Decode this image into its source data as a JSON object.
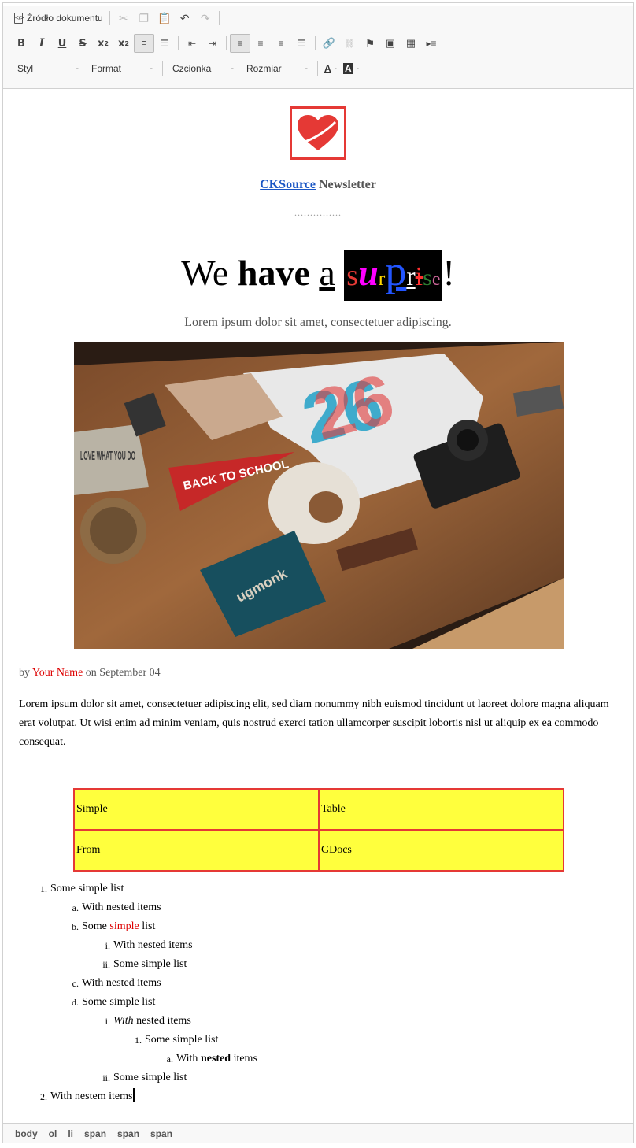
{
  "toolbar": {
    "source_label": "Źródło dokumentu",
    "combos": {
      "style": "Styl",
      "format": "Format",
      "font": "Czcionka",
      "size": "Rozmiar"
    },
    "font_color_glyph": "A",
    "bg_color_glyph": "A"
  },
  "content": {
    "newsletter": {
      "brand": "CKSource",
      "suffix": " Newsletter"
    },
    "dots": "...............",
    "headline": {
      "w1": "We",
      "w2": "have",
      "w3": "a",
      "surprise_letters": [
        "s",
        "u",
        "r",
        "p",
        "r",
        "i",
        "s",
        "e"
      ],
      "end": "!"
    },
    "lead": "Lorem ipsum dolor sit amet, consectetuer adipiscing.",
    "byline": {
      "by": "by ",
      "name": "Your Name",
      "rest": " on September 04"
    },
    "paragraph": "Lorem ipsum dolor sit amet, consectetuer adipiscing elit, sed diam nonummy nibh euismod tincidunt ut laoreet dolore magna aliquam erat volutpat. Ut wisi enim ad minim veniam, quis nostrud exerci tation ullamcorper suscipit lobortis nisl ut aliquip ex ea commodo consequat.",
    "table": [
      [
        "Simple",
        "Table"
      ],
      [
        "From",
        "GDocs"
      ]
    ],
    "photo_texts": {
      "pennant": "BACK TO SCHOOL",
      "book": "LOVE WHAT YOU DO",
      "card": "ugmonk"
    }
  },
  "lists": {
    "i1": "Some simple list",
    "i1a": "With nested items",
    "i1b_pre": "Some ",
    "i1b_red": "simple",
    "i1b_post": " list",
    "i1b_i": "With nested items",
    "i1b_ii": "Some simple list",
    "i1c": "With nested items",
    "i1d": "Some simple list",
    "i1d_i_it": "With",
    "i1d_i_rest": " nested items",
    "i1d_i_1": "Some simple list",
    "i1d_i_1a_pre": "With ",
    "i1d_i_1a_bold": "nested",
    "i1d_i_1a_post": " items",
    "i1d_ii": "Some simple list",
    "i2": "With nestem items",
    "markers": {
      "n1": "1.",
      "n2": "2.",
      "a": "a.",
      "b": "b.",
      "c": "c.",
      "d": "d.",
      "ri": "i.",
      "rii": "ii."
    }
  },
  "path": [
    "body",
    "ol",
    "li",
    "span",
    "span",
    "span"
  ],
  "colors": {
    "accent_red": "#e53935",
    "link_blue": "#1a56c4",
    "table_fill": "#ffff3d",
    "surprise": [
      "#e53935",
      "#ff00ff",
      "#ffd700",
      "#0000ff",
      "#ffffff",
      "#ff3030",
      "#2e7d32",
      "#cc6699"
    ]
  }
}
